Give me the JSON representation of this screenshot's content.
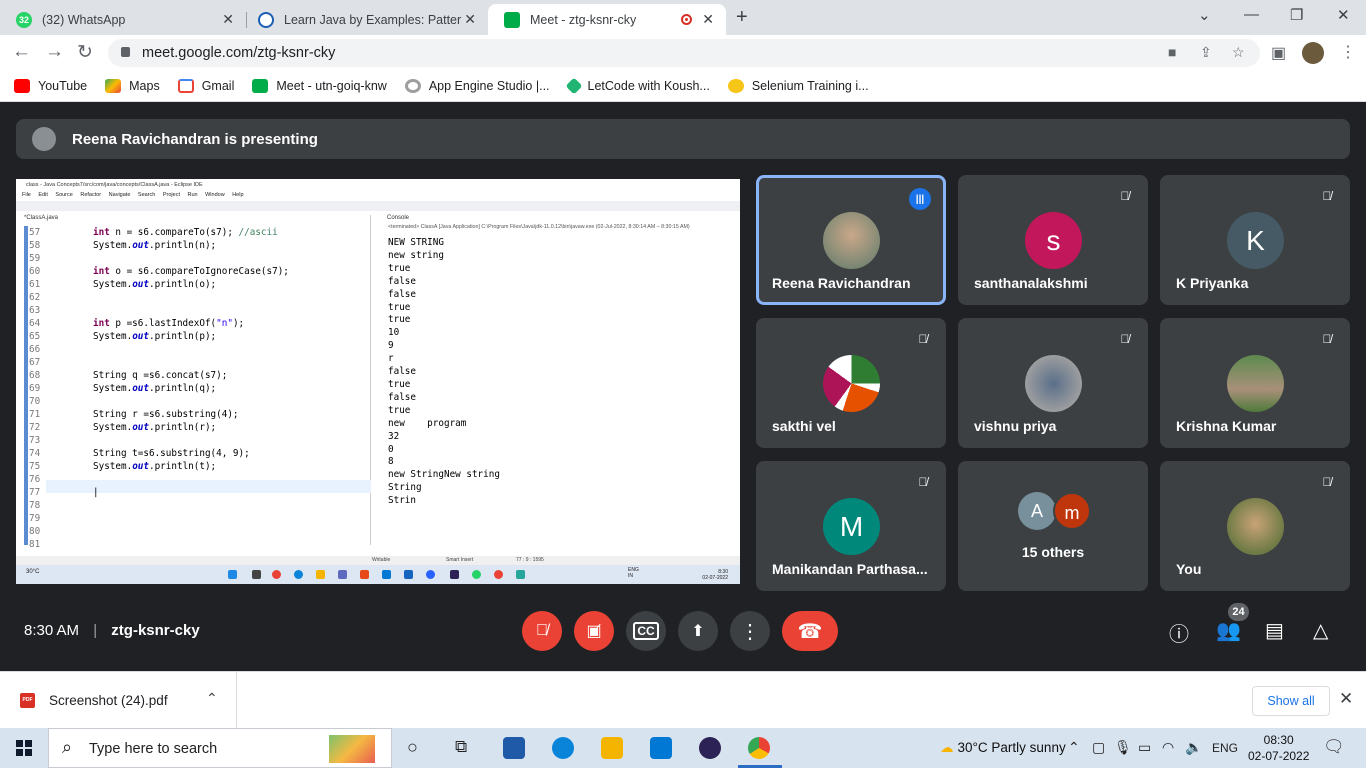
{
  "browser": {
    "tabs": [
      {
        "title": "(32) WhatsApp",
        "favicon_badge": "32"
      },
      {
        "title": "Learn Java by Examples: Pattern p"
      },
      {
        "title": "Meet - ztg-ksnr-cky",
        "active": true
      }
    ],
    "url": "meet.google.com/ztg-ksnr-cky",
    "bookmarks": [
      "YouTube",
      "Maps",
      "Gmail",
      "Meet - utn-goiq-knw",
      "App Engine Studio |...",
      "LetCode with Koush...",
      "Selenium Training i..."
    ]
  },
  "meet": {
    "presenting_banner": "Reena Ravichandran is presenting",
    "time": "8:30 AM",
    "meeting_code": "ztg-ksnr-cky",
    "people_count": "24",
    "tiles": [
      {
        "name": "Reena Ravichandran",
        "speaking": true
      },
      {
        "name": "santhanalakshmi",
        "initial": "s",
        "color": "#c2185b"
      },
      {
        "name": "K Priyanka",
        "initial": "K",
        "color": "#455a64"
      },
      {
        "name": "sakthi vel"
      },
      {
        "name": "vishnu priya"
      },
      {
        "name": "Krishna Kumar"
      },
      {
        "name": "Manikandan Parthasa...",
        "initial": "M",
        "color": "#00897b"
      },
      {
        "name": "15 others",
        "initials": [
          "A",
          "m"
        ]
      },
      {
        "name": "You"
      }
    ]
  },
  "shared_screen": {
    "title": "class - Java Concepts7/src/com/java/concepts/ClassA.java - Eclipse IDE",
    "menu": "File Edit Source Refactor Navigate Search Project Run Window Help",
    "editor_tab": "*ClassA.java",
    "line_numbers": [
      "57",
      "58",
      "59",
      "60",
      "61",
      "62",
      "63",
      "64",
      "65",
      "66",
      "67",
      "68",
      "69",
      "70",
      "71",
      "72",
      "73",
      "74",
      "75",
      "76",
      "77",
      "78",
      "79",
      "80",
      "81"
    ],
    "console_tab": "Console",
    "console_header": "<terminated> ClassA [Java Application] C:\\Program Files\\Java\\jdk-11.0.12\\bin\\javaw.exe (02-Jul-2022, 8:30:14 AM – 8:30:15 AM)",
    "console_output": [
      "NEW STRING",
      "new string",
      "true",
      "false",
      "false",
      "true",
      "true",
      "10",
      "9",
      "r",
      "false",
      "true",
      "false",
      "true",
      "new    program",
      "32",
      "0",
      "8",
      "new StringNew string",
      "String",
      "Strin"
    ],
    "status": {
      "writable": "Writable",
      "insert": "Smart Insert",
      "pos": "77 : 9 : 1595"
    },
    "taskbar_weather": "30°C",
    "taskbar_lang": "ENG\nIN",
    "taskbar_time": "8:30",
    "taskbar_date": "02-07-2022"
  },
  "download": {
    "filename": "Screenshot (24).pdf",
    "show_all": "Show all"
  },
  "taskbar": {
    "search_placeholder": "Type here to search",
    "weather": "30°C  Partly sunny",
    "lang": "ENG",
    "time": "08:30",
    "date": "02-07-2022"
  }
}
